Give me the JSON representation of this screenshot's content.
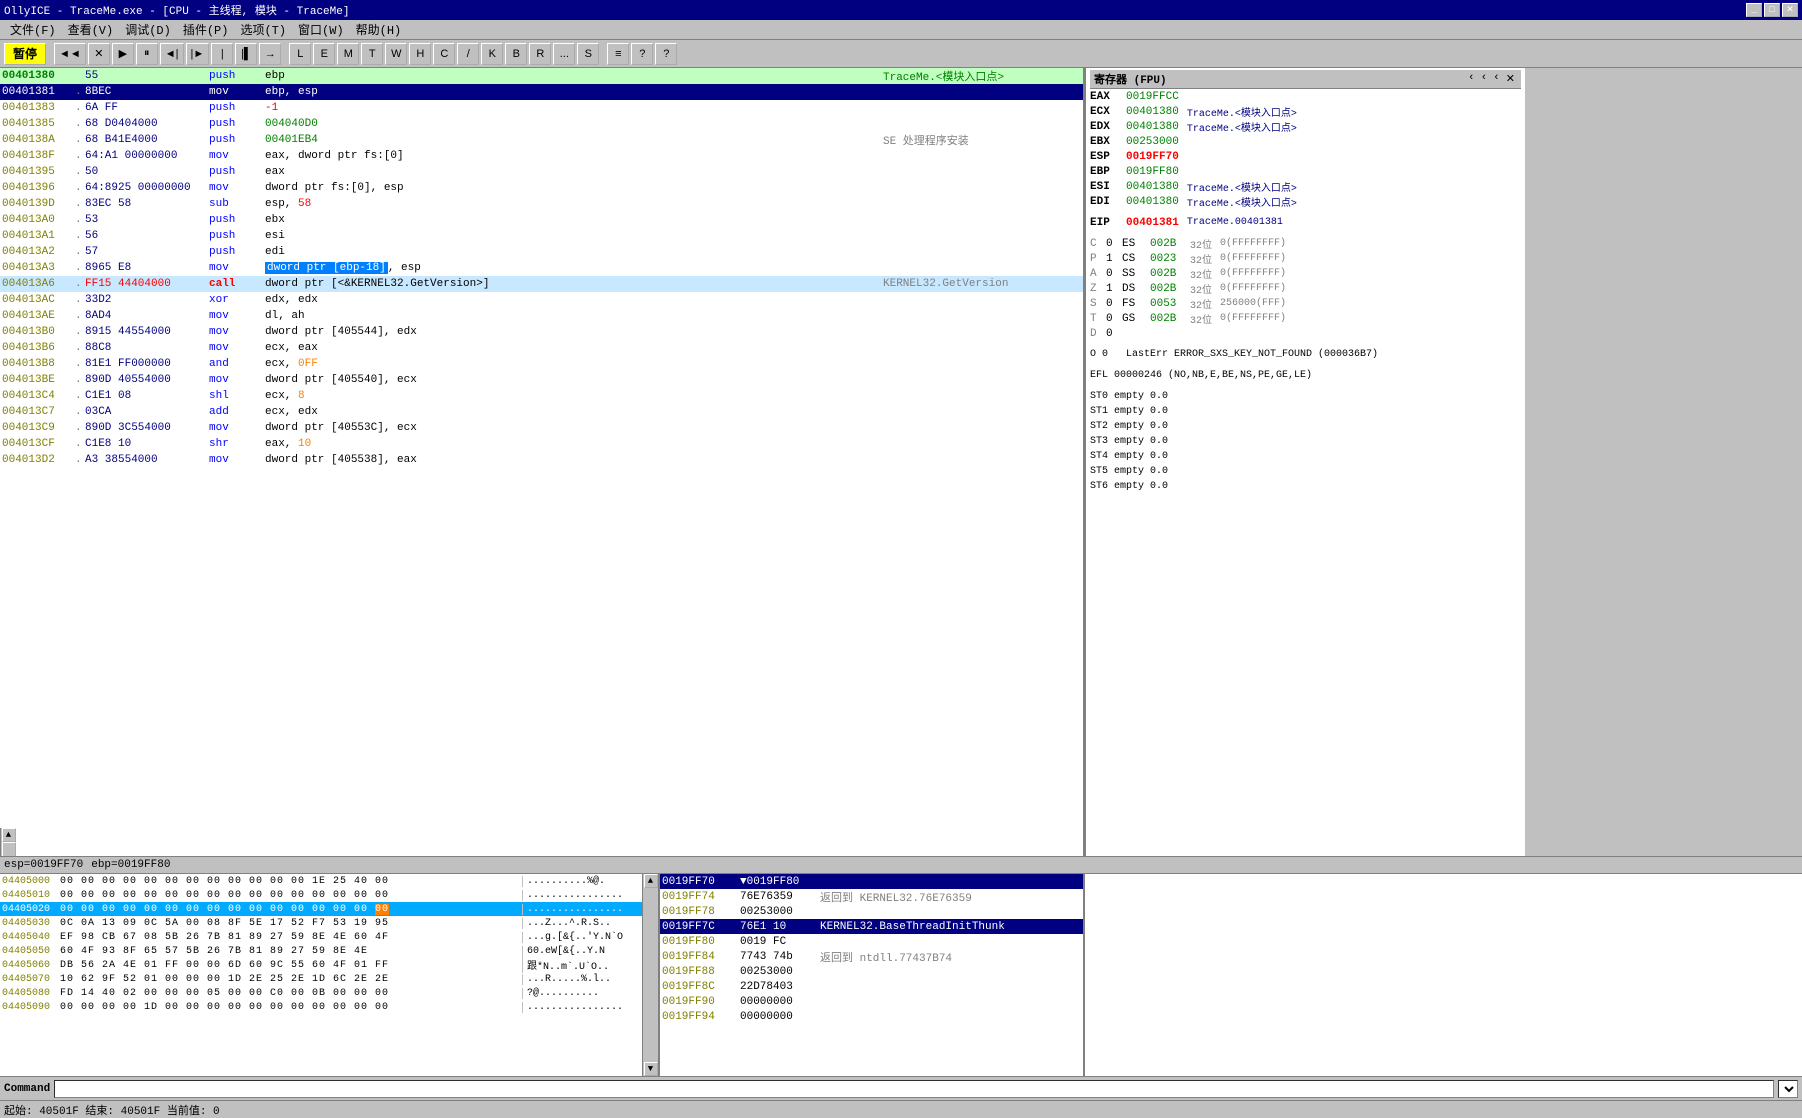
{
  "titleBar": {
    "title": "OllyICE - TraceMe.exe - [CPU - 主线程, 模块 - TraceMe]",
    "controls": [
      "_",
      "□",
      "✕"
    ]
  },
  "menuBar": {
    "items": [
      "文件(F)",
      "查看(V)",
      "调试(D)",
      "插件(P)",
      "选项(T)",
      "窗口(W)",
      "帮助(H)"
    ]
  },
  "toolbar": {
    "pause": "暂停",
    "buttons": [
      "◄◄",
      "×",
      "►",
      "||",
      "◄|",
      "|►",
      "|",
      "|▌",
      "→",
      "L",
      "E",
      "M",
      "T",
      "W",
      "H",
      "C",
      "/",
      "K",
      "B",
      "R",
      "...",
      "S",
      "≡",
      "?",
      "?"
    ]
  },
  "disasm": {
    "rows": [
      {
        "addr": "00401380",
        "dot": " ",
        "hex": "55",
        "mnem": "push",
        "ops": "ebp",
        "comment": "TraceMe.<模块入口点>",
        "type": "entry"
      },
      {
        "addr": "00401381",
        "dot": ".",
        "hex": "8BEC",
        "mnem": "mov",
        "ops": "ebp, esp",
        "comment": "",
        "type": "selected"
      },
      {
        "addr": "00401383",
        "dot": ".",
        "hex": "6A FF",
        "mnem": "push",
        "ops": "-1",
        "comment": "",
        "type": ""
      },
      {
        "addr": "00401385",
        "dot": ".",
        "hex": "68 D0404000",
        "mnem": "push",
        "ops": "004040D0",
        "comment": "",
        "type": ""
      },
      {
        "addr": "0040138A",
        "dot": ".",
        "hex": "68 B41E4000",
        "mnem": "push",
        "ops": "00401EB4",
        "comment": "SE 处理程序安装",
        "type": ""
      },
      {
        "addr": "0040138F",
        "dot": ".",
        "hex": "64:A1 00000000",
        "mnem": "mov",
        "ops": "eax, dword ptr fs:[0]",
        "comment": "",
        "type": ""
      },
      {
        "addr": "00401395",
        "dot": ".",
        "hex": "50",
        "mnem": "push",
        "ops": "eax",
        "comment": "",
        "type": ""
      },
      {
        "addr": "00401396",
        "dot": ".",
        "hex": "64:8925 00000000",
        "mnem": "mov",
        "ops": "dword ptr fs:[0], esp",
        "comment": "",
        "type": ""
      },
      {
        "addr": "0040139D",
        "dot": ".",
        "hex": "83EC 58",
        "mnem": "sub",
        "ops": "esp, 58",
        "comment": "",
        "type": ""
      },
      {
        "addr": "004013A0",
        "dot": ".",
        "hex": "53",
        "mnem": "push",
        "ops": "ebx",
        "comment": "",
        "type": ""
      },
      {
        "addr": "004013A1",
        "dot": ".",
        "hex": "56",
        "mnem": "push",
        "ops": "esi",
        "comment": "",
        "type": ""
      },
      {
        "addr": "004013A2",
        "dot": ".",
        "hex": "57",
        "mnem": "push",
        "ops": "edi",
        "comment": "",
        "type": ""
      },
      {
        "addr": "004013A3",
        "dot": ".",
        "hex": "8965 E8",
        "mnem": "mov",
        "ops": "dword ptr [ebp-18], esp",
        "comment": "",
        "type": "highlight-ops"
      },
      {
        "addr": "004013A6",
        "dot": ".",
        "hex": "FF15 44404000",
        "mnem": "call",
        "ops": "dword ptr [<&KERNEL32.GetVersion>]",
        "comment": "KERNEL32.GetVersion",
        "type": "call-highlight"
      },
      {
        "addr": "004013AC",
        "dot": ".",
        "hex": "33D2",
        "mnem": "xor",
        "ops": "edx, edx",
        "comment": "",
        "type": ""
      },
      {
        "addr": "004013AE",
        "dot": ".",
        "hex": "8AD4",
        "mnem": "mov",
        "ops": "dl, ah",
        "comment": "",
        "type": ""
      },
      {
        "addr": "004013B0",
        "dot": ".",
        "hex": "8915 44554000",
        "mnem": "mov",
        "ops": "dword ptr [405544], edx",
        "comment": "",
        "type": ""
      },
      {
        "addr": "004013B6",
        "dot": ".",
        "hex": "88C8",
        "mnem": "mov",
        "ops": "ecx, eax",
        "comment": "",
        "type": ""
      },
      {
        "addr": "004013B8",
        "dot": ".",
        "hex": "81E1 FF000000",
        "mnem": "and",
        "ops": "ecx, 0FF",
        "comment": "",
        "type": ""
      },
      {
        "addr": "004013BE",
        "dot": ".",
        "hex": "890D 40554000",
        "mnem": "mov",
        "ops": "dword ptr [405540], ecx",
        "comment": "",
        "type": ""
      },
      {
        "addr": "004013C4",
        "dot": ".",
        "hex": "C1E1 08",
        "mnem": "shl",
        "ops": "ecx, 8",
        "comment": "",
        "type": ""
      },
      {
        "addr": "004013C7",
        "dot": ".",
        "hex": "03CA",
        "mnem": "add",
        "ops": "ecx, edx",
        "comment": "",
        "type": ""
      },
      {
        "addr": "004013C9",
        "dot": ".",
        "hex": "890D 3C554000",
        "mnem": "mov",
        "ops": "dword ptr [40553C], ecx",
        "comment": "",
        "type": ""
      },
      {
        "addr": "004013CF",
        "dot": ".",
        "hex": "C1E8 10",
        "mnem": "shr",
        "ops": "eax, 10",
        "comment": "",
        "type": ""
      },
      {
        "addr": "004013D2",
        "dot": ".",
        "hex": "A3 38554000",
        "mnem": "mov",
        "ops": "dword ptr [405538], eax",
        "comment": "",
        "type": ""
      }
    ]
  },
  "registers": {
    "title": "寄存器 (FPU)",
    "items": [
      {
        "name": "EAX",
        "val": "0019FFCC",
        "label": ""
      },
      {
        "name": "ECX",
        "val": "00401380",
        "label": "TraceMe.<模块入口点>"
      },
      {
        "name": "EDX",
        "val": "00401380",
        "label": "TraceMe.<模块入口点>"
      },
      {
        "name": "EBX",
        "val": "00253000",
        "label": ""
      },
      {
        "name": "ESP",
        "val": "0019FF70",
        "label": "",
        "red": true
      },
      {
        "name": "EBP",
        "val": "0019FF80",
        "label": ""
      },
      {
        "name": "ESI",
        "val": "00401380",
        "label": "TraceMe.<模块入口点>"
      },
      {
        "name": "EDI",
        "val": "00401380",
        "label": "TraceMe.<模块入口点>"
      },
      {
        "name": "EIP",
        "val": "00401381",
        "label": "TraceMe.00401381",
        "red": true
      }
    ],
    "segments": [
      {
        "flag": "C",
        "fval": "0",
        "name": "ES",
        "val": "002B",
        "bits": "32位",
        "range": "0(FFFFFFFF)"
      },
      {
        "flag": "P",
        "fval": "1",
        "name": "CS",
        "val": "0023",
        "bits": "32位",
        "range": "0(FFFFFFFF)"
      },
      {
        "flag": "A",
        "fval": "0",
        "name": "SS",
        "val": "002B",
        "bits": "32位",
        "range": "0(FFFFFFFF)"
      },
      {
        "flag": "Z",
        "fval": "1",
        "name": "DS",
        "val": "002B",
        "bits": "32位",
        "range": "0(FFFFFFFF)"
      },
      {
        "flag": "S",
        "fval": "0",
        "name": "FS",
        "val": "0053",
        "bits": "32位",
        "range": "256000(FFF)"
      },
      {
        "flag": "T",
        "fval": "0",
        "name": "GS",
        "val": "002B",
        "bits": "32位",
        "range": "0(FFFFFFFF)"
      },
      {
        "flag": "D",
        "fval": "0",
        "name": "",
        "val": "",
        "bits": "",
        "range": ""
      }
    ],
    "lastErr": "LastErr ERROR_SXS_KEY_NOT_FOUND (000036B7)",
    "efl": "EFL 00000246 (NO,NB,E,BE,NS,PE,GE,LE)",
    "fpu": [
      "ST0 empty 0.0",
      "ST1 empty 0.0",
      "ST2 empty 0.0",
      "ST3 empty 0.0",
      "ST4 empty 0.0",
      "ST5 empty 0.0",
      "ST6 empty 0.0"
    ]
  },
  "statusMini": "esp=0019FF70\nebp=0019FF80",
  "hexDump": {
    "rows": [
      {
        "addr": "04405000",
        "bytes": "00 00 00 00 00 00 00 00 00 00 00 00 1E 25 40 00",
        "ascii": "..........%@."
      },
      {
        "addr": "04405010",
        "bytes": "00 00 00 00 00 00 00 00 00 00 00 00 00 00 00 00",
        "ascii": "................"
      },
      {
        "addr": "04405020",
        "bytes": "00 00 00 00 00 00 00 00 00 00 00 00 00 00 00 00",
        "ascii": "................"
      },
      {
        "addr": "04405030",
        "bytes": "0C 0A 13 09 0C 5A 00 08 8F 5E 17 52 F7 53 19 95",
        "ascii": "...Z...^.R.S.."
      },
      {
        "addr": "04405040",
        "bytes": "EF 98 CB 67 08 5B 26 7B 81 89 27 59 8E 4E",
        "ascii": "...g.[&{..'Y.N"
      },
      {
        "addr": "04405050",
        "bytes": "60 4F 93 8F 65 57 5B 26 7B 81 89 27 59 8E 4E",
        "ascii": "60.e.W[&{..'Y.N"
      },
      {
        "addr": "04405060",
        "bytes": "DB 56 2A 4E 01 FF 00 00 6D 60 9C 55 60 4F 01 FF",
        "ascii": "跟*N.m`.U`O.."
      },
      {
        "addr": "04405070",
        "bytes": "10 62 9F 52 01 00 00 00 1D 2E 25 2E 1D 6C 2E 2E",
        "ascii": "...R.....%.l.."
      },
      {
        "addr": "04405080",
        "bytes": "FD 14 40 02 00 00 00 05 00 00 C0 00 0B 00 00 00",
        "ascii": "?@.........."
      },
      {
        "addr": "04405090",
        "bytes": "00 00 00 00 1D 00 00 00 00 00 00 00 00 00 00 00",
        "ascii": "................"
      }
    ]
  },
  "stack": {
    "rows": [
      {
        "addr": "0019FF70",
        "val": "▼0019FF80",
        "comment": "",
        "selected": true
      },
      {
        "addr": "0019FF74",
        "val": "76E76359",
        "comment": "返回到 KERNEL32.76E76359",
        "selected": false
      },
      {
        "addr": "0019FF78",
        "val": "00253000",
        "comment": "",
        "selected": false
      },
      {
        "addr": "0019FF7C",
        "val": "76E1 10",
        "comment": "KERNEL32.BaseThreadInitThunk",
        "selected": true,
        "highlight": true
      },
      {
        "addr": "0019FF80",
        "val": "0019 FC",
        "comment": "",
        "selected": false
      },
      {
        "addr": "0019FF84",
        "val": "7743 74b",
        "comment": "返回到 ntdll.77437B74",
        "selected": false
      },
      {
        "addr": "0019FF88",
        "val": "00253000",
        "comment": "",
        "selected": false
      },
      {
        "addr": "0019FF8C",
        "val": "22D78403",
        "comment": "",
        "selected": false
      },
      {
        "addr": "0019FF90",
        "val": "00000000",
        "comment": "",
        "selected": false
      },
      {
        "addr": "0019FF94",
        "val": "00000000",
        "comment": "",
        "selected": false
      }
    ]
  },
  "commandBar": {
    "label": "Command",
    "placeholder": ""
  },
  "statusBottom": {
    "text": "起始: 40501F  结束: 40501F  当前值: 0"
  }
}
